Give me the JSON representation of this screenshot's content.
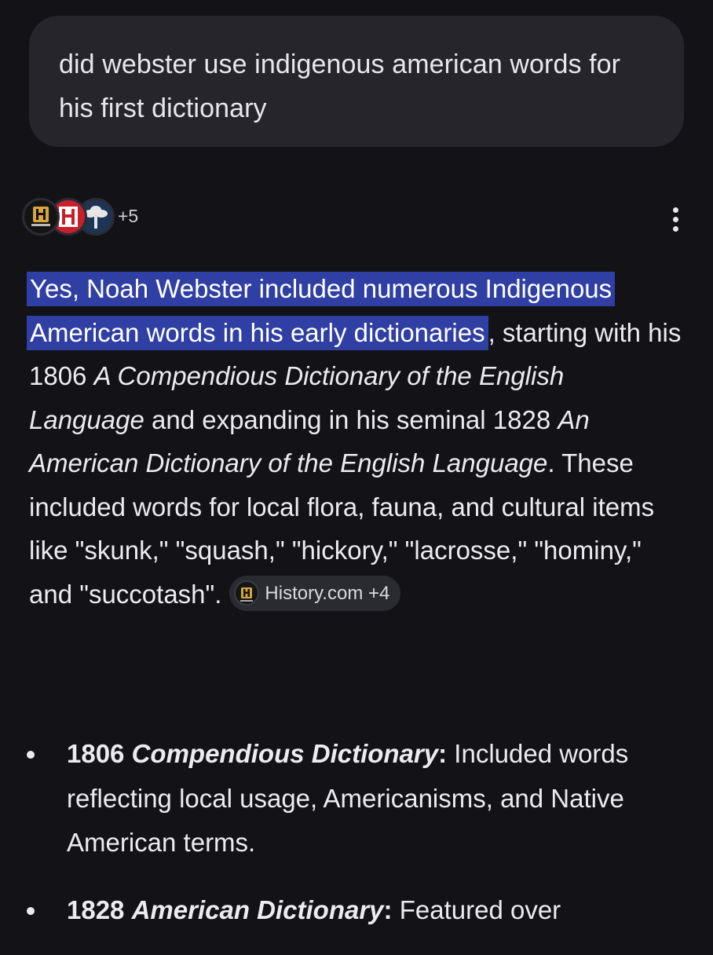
{
  "query": {
    "text": "did webster use indigenous american words for his first dictionary"
  },
  "sources": {
    "favicons": [
      "history-icon",
      "history-red-icon",
      "tree-icon"
    ],
    "more_count": "+5",
    "menu_icon": "more-vert-icon"
  },
  "answer": {
    "highlight": "Yes, Noah Webster included numerous Indigenous American words in his early dictionaries",
    "part1": ", starting with his 1806 ",
    "title1": "A Compendious Dictionary of the English Language",
    "part2": " and expanding in his seminal 1828 ",
    "title2": "An American Dictionary of the English Language",
    "part3": ". These included words for local flora, fauna, and cultural items like \"skunk,\" \"squash,\" \"hickory,\" \"lacrosse,\" \"hominy,\" and \"succotash\".",
    "citation": {
      "label": "History.com +4",
      "icon": "history-icon"
    }
  },
  "bullets": [
    {
      "year": "1806 ",
      "title": "Compendious Dictionary",
      "colon": ":",
      "text": " Included words reflecting local usage, Americanisms, and Native American terms."
    },
    {
      "year": "1828 ",
      "title": "American Dictionary",
      "colon": ":",
      "text": " Featured over"
    }
  ],
  "colors": {
    "background": "#131317",
    "bubble": "#25252b",
    "highlight": "#2f3fa3",
    "text": "#ececf0"
  }
}
